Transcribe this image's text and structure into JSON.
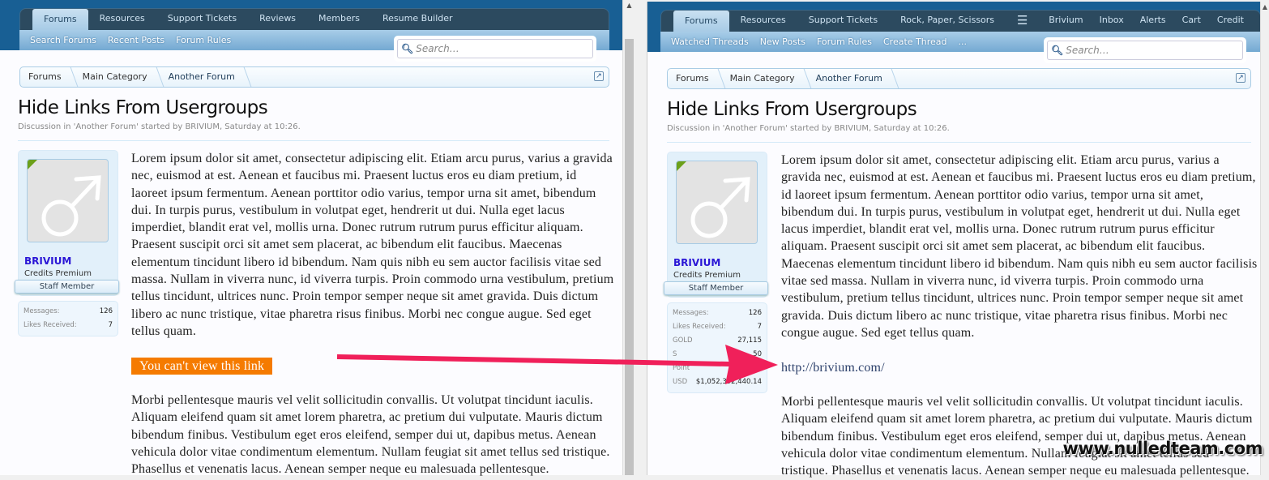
{
  "left": {
    "tabs": [
      "Forums",
      "Resources",
      "Support Tickets",
      "Reviews",
      "Members",
      "Resume Builder"
    ],
    "subnav": [
      "Search Forums",
      "Recent Posts",
      "Forum Rules"
    ],
    "search_placeholder": "Search…",
    "crumbs": [
      "Forums",
      "Main Category",
      "Another Forum"
    ],
    "title": "Hide Links From Usergroups",
    "meta": "Discussion in 'Another Forum' started by BRIVIUM, Saturday at 10:26.",
    "user": {
      "name": "BRIVIUM",
      "title": "Credits Premium",
      "badge": "Staff Member",
      "stats": [
        {
          "label": "Messages:",
          "value": "126"
        },
        {
          "label": "Likes Received:",
          "value": "7"
        }
      ]
    },
    "p1": "Lorem ipsum dolor sit amet, consectetur adipiscing elit. Etiam arcu purus, varius a gravida nec, euismod at est. Aenean et faucibus mi. Praesent luctus eros eu diam pretium, id laoreet ipsum fermentum. Aenean porttitor odio varius, tempor urna sit amet, bibendum dui. In turpis purus, vestibulum in volutpat eget, hendrerit ut dui. Nulla eget lacus imperdiet, blandit erat vel, mollis urna. Donec rutrum rutrum purus efficitur aliquam. Praesent suscipit orci sit amet sem placerat, ac bibendum elit faucibus. Maecenas elementum tincidunt libero id bibendum. Nam quis nibh eu sem auctor facilisis vitae sed massa. Nullam in viverra nunc, id viverra turpis. Proin commodo urna vestibulum, pretium tellus tincidunt, ultrices nunc. Proin tempor semper neque sit amet gravida. Duis dictum libero ac nunc tristique, vitae pharetra risus finibus. Morbi nec congue augue. Sed eget tellus quam.",
    "link": "You can't view this link",
    "p2": "Morbi pellentesque mauris vel velit sollicitudin convallis. Ut volutpat tincidunt iaculis. Aliquam eleifend quam sit amet lorem pharetra, ac pretium dui vulputate. Mauris dictum bibendum finibus. Vestibulum eget eros eleifend, semper dui ut, dapibus metus. Aenean vehicula dolor vitae condimentum elementum. Nullam feugiat sit amet tellus sed tristique. Phasellus et venenatis lacus. Aenean semper neque eu malesuada pellentesque."
  },
  "right": {
    "tabs": [
      "Forums",
      "Resources",
      "Support Tickets",
      "Rock, Paper, Scissors"
    ],
    "menu_icon": "hamburger-icon",
    "account": [
      "Brivium",
      "Inbox",
      "Alerts",
      "Cart",
      "Credit"
    ],
    "subnav": [
      "Watched Threads",
      "New Posts",
      "Forum Rules",
      "Create Thread",
      "..."
    ],
    "search_placeholder": "Search…",
    "crumbs": [
      "Forums",
      "Main Category",
      "Another Forum"
    ],
    "title": "Hide Links From Usergroups",
    "meta": "Discussion in 'Another Forum' started by BRIVIUM, Saturday at 10:26.",
    "user": {
      "name": "BRIVIUM",
      "title": "Credits Premium",
      "badge": "Staff Member",
      "stats": [
        {
          "label": "Messages:",
          "value": "126"
        },
        {
          "label": "Likes Received:",
          "value": "7"
        },
        {
          "label": "GOLD",
          "value": "27,115"
        },
        {
          "label": "S",
          "value": "50"
        },
        {
          "label": "Point",
          "value": ""
        },
        {
          "label": "USD",
          "value": "$1,052,392,440.14"
        }
      ]
    },
    "p1": "Lorem ipsum dolor sit amet, consectetur adipiscing elit. Etiam arcu purus, varius a gravida nec, euismod at est. Aenean et faucibus mi. Praesent luctus eros eu diam pretium, id laoreet ipsum fermentum. Aenean porttitor odio varius, tempor urna sit amet, bibendum dui. In turpis purus, vestibulum in volutpat eget, hendrerit ut dui. Nulla eget lacus imperdiet, blandit erat vel, mollis urna. Donec rutrum rutrum purus efficitur aliquam. Praesent suscipit orci sit amet sem placerat, ac bibendum elit faucibus. Maecenas elementum tincidunt libero id bibendum. Nam quis nibh eu sem auctor facilisis vitae sed massa. Nullam in viverra nunc, id viverra turpis. Proin commodo urna vestibulum, pretium tellus tincidunt, ultrices nunc. Proin tempor semper neque sit amet gravida. Duis dictum libero ac nunc tristique, vitae pharetra risus finibus. Morbi nec congue augue. Sed eget tellus quam.",
    "link": "http://brivium.com/",
    "p2": "Morbi pellentesque mauris vel velit sollicitudin convallis. Ut volutpat tincidunt iaculis. Aliquam eleifend quam sit amet lorem pharetra, ac pretium dui vulputate. Mauris dictum bibendum finibus. Vestibulum eget eros eleifend, semper dui ut, dapibus metus. Aenean vehicula dolor vitae condimentum elementum. Nullam feugiat sit amet tellus sed tristique. Phasellus et venenatis lacus. Aenean semper neque eu malesuada pellentesque."
  },
  "watermark": "www.nulledteam.com",
  "colors": {
    "hidden_link_bg": "#f57b00",
    "arrow": "#f0205a",
    "nav_dark": "#2c4a5f",
    "username": "#2a16d6"
  }
}
